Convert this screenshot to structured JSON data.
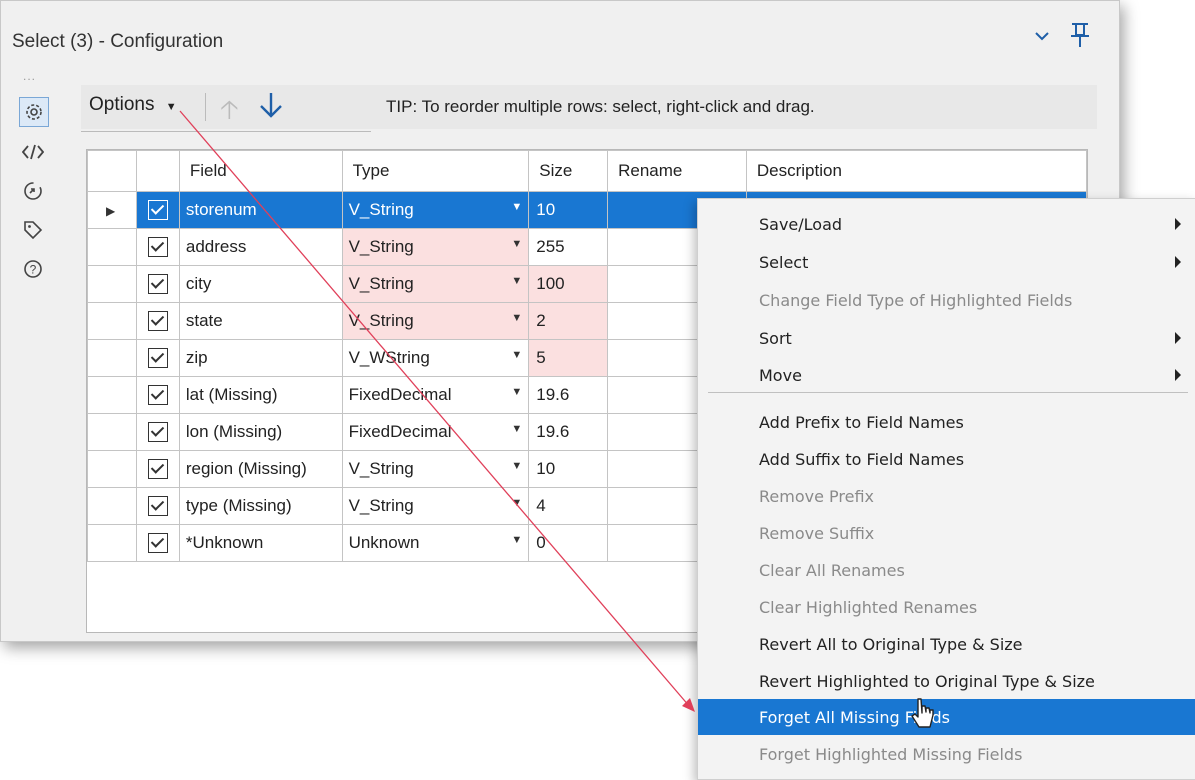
{
  "window": {
    "title": "Select (3) - Configuration",
    "collapse_icon": "chevron-down-icon",
    "pin_icon": "pin-icon",
    "overflow_dots": "..."
  },
  "rail": [
    "gear-icon",
    "code-icon",
    "arrow-cycle-icon",
    "tag-icon",
    "help-icon"
  ],
  "toolbar": {
    "options_label": "Options",
    "tip": "TIP: To reorder multiple rows: select, right-click and drag."
  },
  "grid": {
    "columns": [
      "Field",
      "Type",
      "Size",
      "Rename",
      "Description"
    ],
    "rows": [
      {
        "field": "storenum",
        "type": "V_String",
        "size": "10",
        "checked": true
      },
      {
        "field": "address",
        "type": "V_String",
        "size": "255",
        "checked": true
      },
      {
        "field": "city",
        "type": "V_String",
        "size": "100",
        "checked": true
      },
      {
        "field": "state",
        "type": "V_String",
        "size": "2",
        "checked": true
      },
      {
        "field": "zip",
        "type": "V_WString",
        "size": "5",
        "checked": true
      },
      {
        "field": "lat (Missing)",
        "type": "FixedDecimal",
        "size": "19.6",
        "checked": true
      },
      {
        "field": "lon (Missing)",
        "type": "FixedDecimal",
        "size": "19.6",
        "checked": true
      },
      {
        "field": "region (Missing)",
        "type": "V_String",
        "size": "10",
        "checked": true
      },
      {
        "field": "type (Missing)",
        "type": "V_String",
        "size": "4",
        "checked": true
      },
      {
        "field": "*Unknown",
        "type": "Unknown",
        "size": "0",
        "checked": true
      }
    ]
  },
  "context_menu": {
    "items": [
      {
        "label": "Save/Load",
        "submenu": true,
        "enabled": true
      },
      {
        "label": "Select",
        "submenu": true,
        "enabled": true
      },
      {
        "label": "Change Field Type of Highlighted Fields",
        "submenu": false,
        "enabled": false
      },
      {
        "label": "Sort",
        "submenu": true,
        "enabled": true
      },
      {
        "label": "Move",
        "submenu": true,
        "enabled": true
      },
      {
        "label": "Add Prefix to Field Names",
        "submenu": false,
        "enabled": true
      },
      {
        "label": "Add Suffix to Field Names",
        "submenu": false,
        "enabled": true
      },
      {
        "label": "Remove Prefix",
        "submenu": false,
        "enabled": false
      },
      {
        "label": "Remove Suffix",
        "submenu": false,
        "enabled": false
      },
      {
        "label": "Clear All Renames",
        "submenu": false,
        "enabled": false
      },
      {
        "label": "Clear Highlighted Renames",
        "submenu": false,
        "enabled": false
      },
      {
        "label": "Revert All to Original Type & Size",
        "submenu": false,
        "enabled": true
      },
      {
        "label": "Revert Highlighted to Original Type & Size",
        "submenu": false,
        "enabled": true
      },
      {
        "label": "Forget All Missing Fields",
        "submenu": false,
        "enabled": true,
        "highlighted": true
      },
      {
        "label": "Forget Highlighted Missing Fields",
        "submenu": false,
        "enabled": false
      }
    ]
  },
  "colors": {
    "accent": "#1977d2",
    "missing_field": "#c9a138",
    "changed_cell": "#fbe0e0",
    "annotation_arrow": "#e0405a"
  }
}
